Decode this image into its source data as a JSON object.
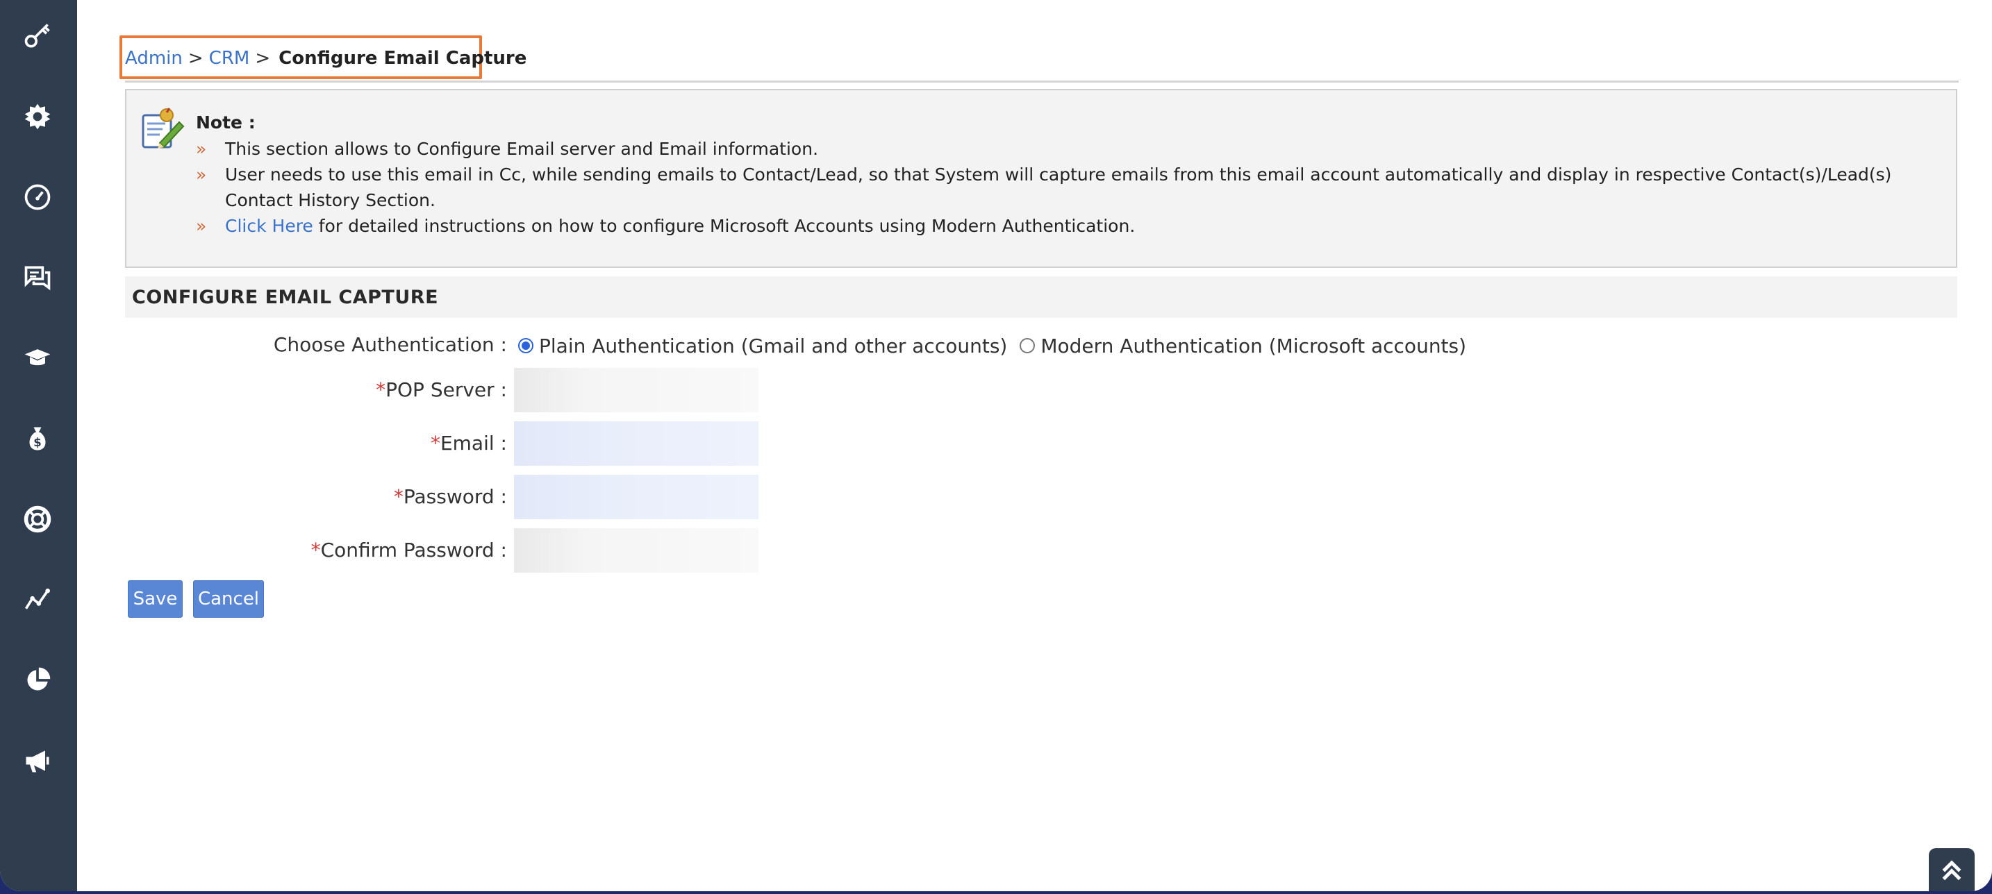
{
  "sidebar": {
    "items": [
      {
        "icon": "key-icon"
      },
      {
        "icon": "gear-icon"
      },
      {
        "icon": "dashboard-gauge-icon"
      },
      {
        "icon": "chat-icon"
      },
      {
        "icon": "graduation-cap-icon"
      },
      {
        "icon": "money-bag-icon"
      },
      {
        "icon": "lifebuoy-icon"
      },
      {
        "icon": "line-chart-icon"
      },
      {
        "icon": "pie-chart-icon"
      },
      {
        "icon": "megaphone-icon"
      }
    ]
  },
  "breadcrumb": {
    "admin": "Admin",
    "crm": "CRM",
    "separator": ">",
    "current": "Configure Email Capture"
  },
  "note": {
    "title": "Note :",
    "bullet": "»",
    "item1": "This section allows to Configure Email server and Email information.",
    "item2": "User needs to use this email in Cc, while sending emails to Contact/Lead, so that System will capture emails from this email account automatically and display in respective Contact(s)/Lead(s) Contact History Section.",
    "link": "Click Here",
    "item3_rest": " for detailed instructions on how to configure Microsoft Accounts using Modern Authentication."
  },
  "section": {
    "title": "CONFIGURE EMAIL CAPTURE"
  },
  "form": {
    "auth_label": "Choose Authentication :",
    "auth_options": [
      {
        "label": "Plain Authentication (Gmail and other accounts)",
        "selected": true
      },
      {
        "label": "Modern Authentication (Microsoft accounts)",
        "selected": false
      }
    ],
    "required_mark": "*",
    "pop_server_label": "POP Server :",
    "pop_server_value": "",
    "email_label": "Email :",
    "email_value": "",
    "password_label": "Password :",
    "password_value": "",
    "confirm_password_label": "Confirm Password :",
    "confirm_password_value": ""
  },
  "buttons": {
    "save": "Save",
    "cancel": "Cancel"
  },
  "colors": {
    "sidebar": "#2f3d4e",
    "link": "#3a73c9",
    "highlight_border": "#e8793b",
    "button": "#5a86d6",
    "required": "#d23b3b"
  }
}
